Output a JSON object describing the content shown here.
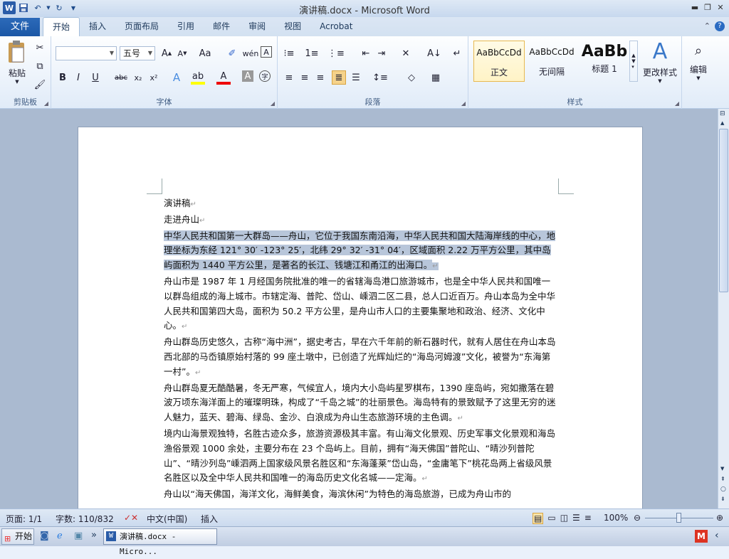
{
  "window": {
    "title": "演讲稿.docx - Microsoft Word"
  },
  "qat": {
    "icons": [
      "word-icon",
      "save-icon",
      "undo-icon",
      "redo-icon",
      "customize-icon"
    ]
  },
  "tabs": {
    "file": "文件",
    "items": [
      "开始",
      "插入",
      "页面布局",
      "引用",
      "邮件",
      "审阅",
      "视图",
      "Acrobat"
    ],
    "active": "开始"
  },
  "ribbon": {
    "clipboard": {
      "label": "剪贴板",
      "paste": "粘贴"
    },
    "font": {
      "label": "字体",
      "font_name": "",
      "font_size": "五号"
    },
    "paragraph": {
      "label": "段落"
    },
    "styles": {
      "label": "样式",
      "items": [
        {
          "sample": "AaBbCcDd",
          "name": "正文"
        },
        {
          "sample": "AaBbCcDd",
          "name": "无间隔"
        },
        {
          "sample": "AaBb",
          "name": "标题 1"
        }
      ],
      "change": "更改样式"
    },
    "editing": {
      "label": "编辑"
    }
  },
  "document": {
    "paragraphs": [
      "演讲稿",
      "走进舟山",
      "中华人民共和国第一大群岛——舟山，它位于我国东南沿海，中华人民共和国大陆海岸线的中心，地理坐标为东经 121° 30′ -123° 25′，北纬 29° 32′ -31° 04′，区域面积 2.22 万平方公里，其中岛屿面积为 1440 平方公里，是著名的长江、钱塘江和甬江的出海口。",
      "舟山市是 1987 年 1 月经国务院批准的唯一的省辖海岛港口旅游城市，也是全中华人民共和国唯一以群岛组成的海上城市。市辖定海、普陀、岱山、嵊泗二区二县，总人口近百万。舟山本岛为全中华人民共和国第四大岛，面积为 50.2 平方公里，是舟山市人口的主要集聚地和政治、经济、文化中心。",
      "舟山群岛历史悠久，古称“海中洲”，据史考古，早在六千年前的新石器时代，就有人居住在舟山本岛西北部的马岙镇原始村落的 99 座土墩中，已创造了光辉灿烂的“海岛河姆渡”文化，被誉为“东海第一村”。",
      "舟山群岛夏无酷酷暑，冬无严寒，气候宜人，境内大小岛屿星罗棋布，1390 座岛屿，宛如撒落在碧波万顷东海洋面上的璀璨明珠，构成了“千岛之城”的壮丽景色。海岛特有的景致赋予了这里无穷的迷人魅力，蓝天、碧海、绿岛、金沙、白浪成为舟山生态旅游环境的主色调。",
      "境内山海景观独特，名胜古迹众多，旅游资源极其丰富。有山海文化景观、历史军事文化景观和海岛渔俗景观 1000 余处，主要分布在 23 个岛屿上。目前，拥有“海天佛国”普陀山、“晴沙列普陀山”、“晴沙列岛”嵊泗两上国家级风景名胜区和“东海蓬莱”岱山岛，“金庸笔下”桃花岛两上省级风景名胜区以及全中华人民共和国唯一的海岛历史文化名城——定海。",
      "舟山以“海天佛国，海洋文化，海鲜美食，海滨休闲”为特色的海岛旅游，已成为舟山市的"
    ],
    "selected_paragraph_index": 2
  },
  "status": {
    "page": "页面: 1/1",
    "words": "字数: 110/832",
    "language": "中文(中国)",
    "mode": "插入",
    "zoom": "100%"
  },
  "taskbar": {
    "start": "开始",
    "window_item": "演讲稿.docx - Micro..."
  }
}
